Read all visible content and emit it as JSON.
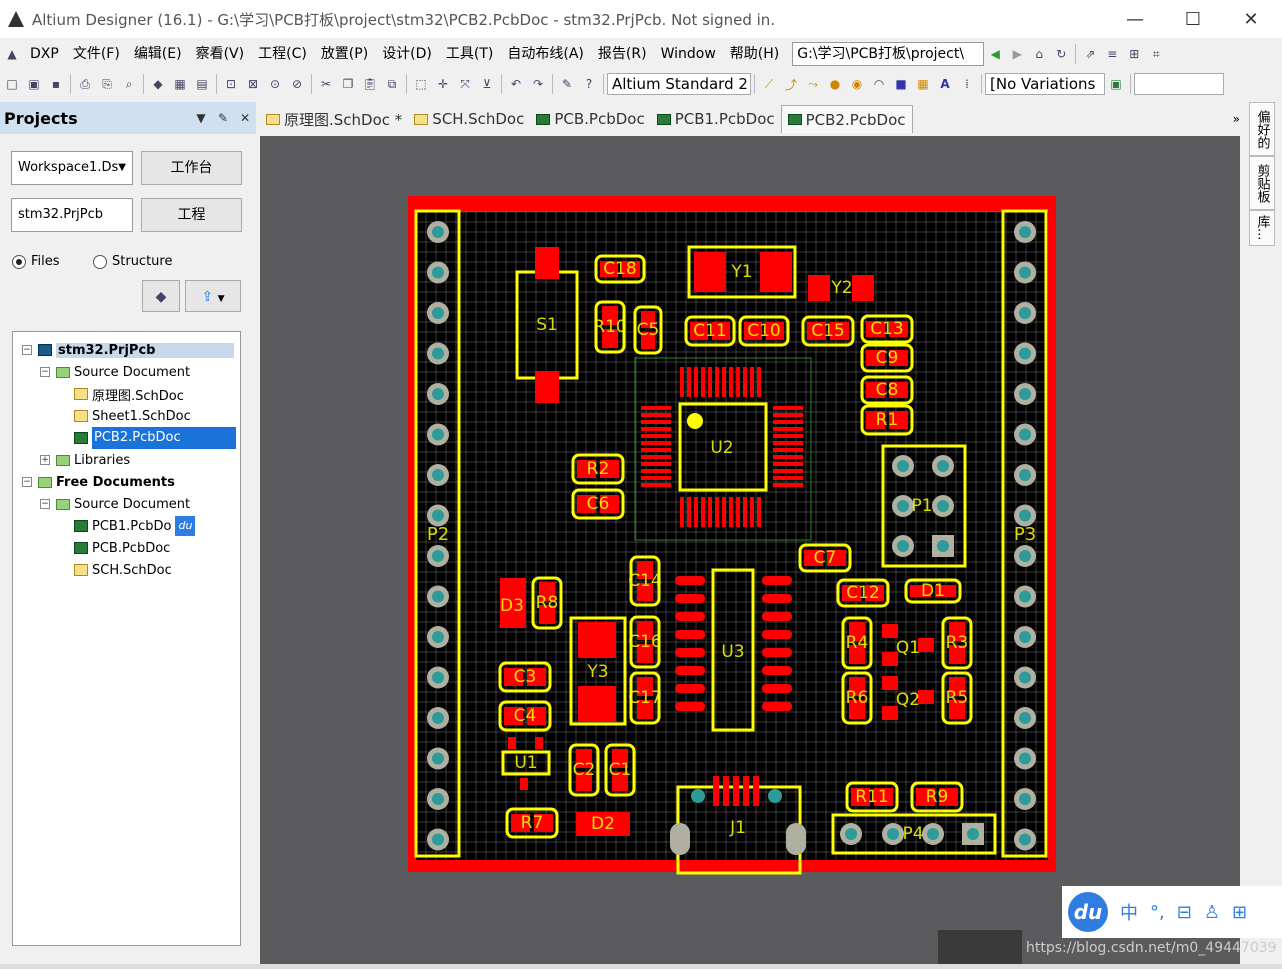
{
  "window": {
    "title": "Altium Designer (16.1) - G:\\学习\\PCB打板\\project\\stm32\\PCB2.PcbDoc - stm32.PrjPcb. Not signed in.",
    "minimize": "—",
    "maximize": "☐",
    "close": "✕"
  },
  "menu": {
    "items": [
      "DXP",
      "文件(F)",
      "编辑(E)",
      "察看(V)",
      "工程(C)",
      "放置(P)",
      "设计(D)",
      "工具(T)",
      "自动布线(A)",
      "报告(R)",
      "Window",
      "帮助(H)"
    ],
    "path": "G:\\学习\\PCB打板\\project\\"
  },
  "toolbar": {
    "standard_combo": "Altium Standard 2",
    "variations_combo": "[No Variations"
  },
  "projects": {
    "title": "Projects",
    "workspace_combo": "Workspace1.Ds",
    "workbench_btn": "工作台",
    "project_combo": "stm32.PrjPcb",
    "project_btn": "工程",
    "radio_files": "Files",
    "radio_structure": "Structure",
    "tree": {
      "project": "stm32.PrjPcb",
      "source_documents": "Source Document",
      "files": [
        "原理图.SchDoc",
        "Sheet1.SchDoc",
        "PCB2.PcbDoc"
      ],
      "libraries": "Libraries",
      "free_documents": "Free Documents",
      "free_source": "Source Document",
      "free_files": [
        "PCB1.PcbDo",
        "PCB.PcbDoc",
        "SCH.SchDoc"
      ]
    }
  },
  "tabs": [
    "原理图.SchDoc *",
    "SCH.SchDoc",
    "PCB.PcbDoc",
    "PCB1.PcbDoc",
    "PCB2.PcbDoc"
  ],
  "side_tabs": [
    "偏好的",
    "剪贴板",
    "库..."
  ],
  "baidu": {
    "logo": "du",
    "ime": "中"
  },
  "watermark": "https://blog.csdn.net/m0_49447039",
  "pcb": {
    "designators": [
      "S1",
      "C18",
      "Y1",
      "Y2",
      "R10",
      "C5",
      "C11",
      "C10",
      "C15",
      "C13",
      "C9",
      "C8",
      "R1",
      "U2",
      "R2",
      "C6",
      "P1",
      "C7",
      "P2",
      "P3",
      "C14",
      "C12",
      "D1",
      "D3",
      "R8",
      "Y3",
      "C16",
      "U3",
      "R4",
      "Q1",
      "R3",
      "C3",
      "C17",
      "R6",
      "Q2",
      "R5",
      "C4",
      "U1",
      "C2",
      "C1",
      "R11",
      "R9",
      "R7",
      "D2",
      "J1",
      "P4"
    ]
  },
  "colors": {
    "board": "#000000",
    "outline": "#ff0000",
    "silk": "#ffff00",
    "pad": "#ff0000",
    "via": "#2e9a9a",
    "grid": "#a0a0a0",
    "workspace": "#5b5a5c"
  }
}
